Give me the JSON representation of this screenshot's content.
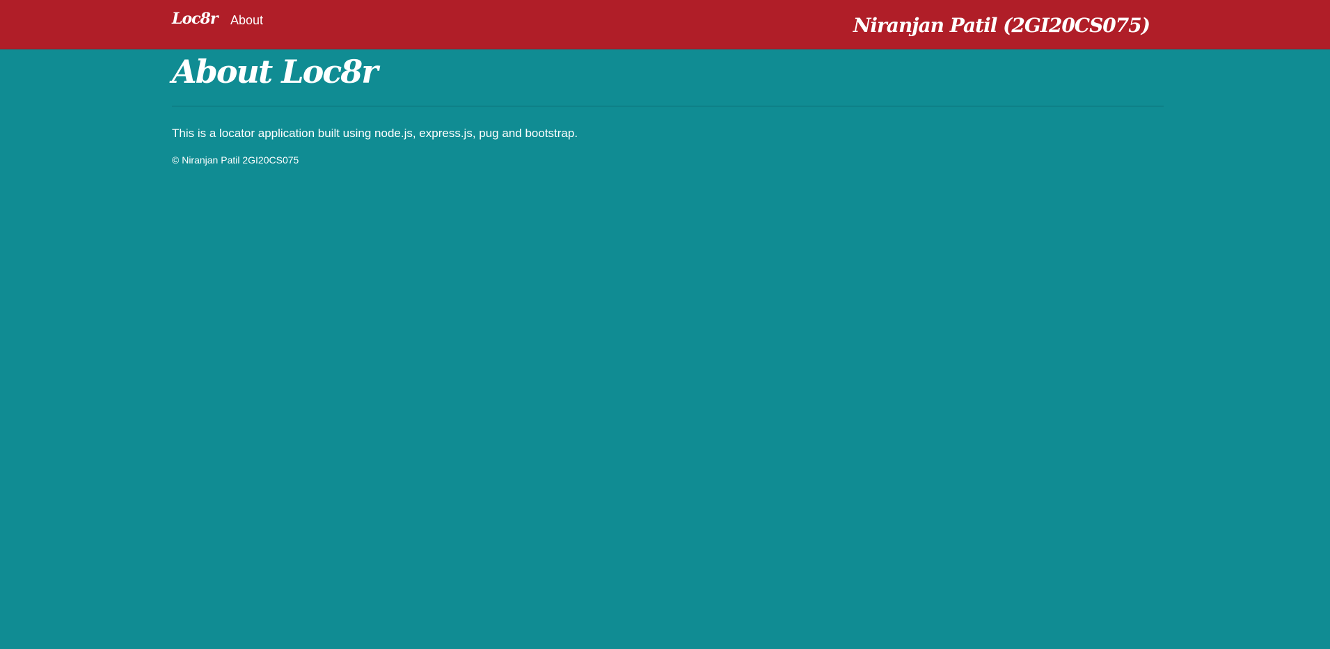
{
  "colors": {
    "navbar": "#b01e28",
    "background": "#108c93",
    "text": "#ffffff"
  },
  "navbar": {
    "brand": "Loc8r",
    "links": [
      {
        "label": "About"
      }
    ],
    "user": "Niranjan Patil (2GI20CS075)"
  },
  "main": {
    "title": "About Loc8r",
    "description": "This is a locator application built using node.js, express.js, pug and bootstrap.",
    "footer": "© Niranjan Patil 2GI20CS075"
  }
}
